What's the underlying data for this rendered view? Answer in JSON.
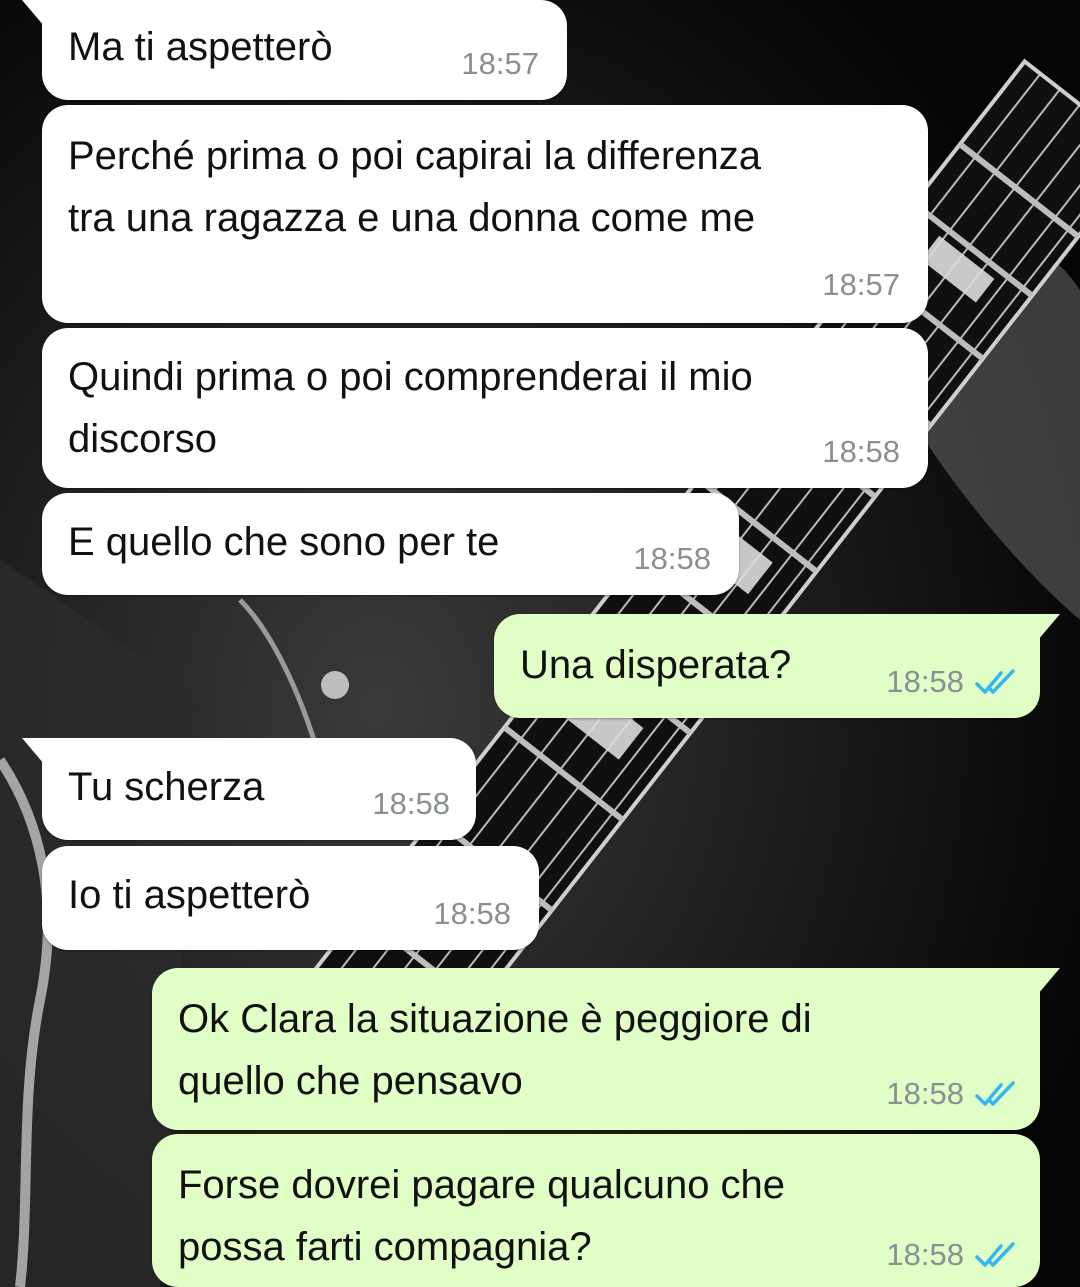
{
  "chat": {
    "accent_tick_color": "#34b7f1",
    "incoming_bubble_color": "#ffffff",
    "outgoing_bubble_color": "#e1fec6",
    "messages": [
      {
        "text": "Ma ti aspetterò",
        "time": "18:57",
        "direction": "incoming",
        "status": ""
      },
      {
        "text": "Perché prima o poi capirai la differenza\ntra una ragazza e una donna come me",
        "time": "18:57",
        "direction": "incoming",
        "status": ""
      },
      {
        "text": "Quindi prima o poi comprenderai il mio\ndiscorso",
        "time": "18:58",
        "direction": "incoming",
        "status": ""
      },
      {
        "text": "E quello che sono per te",
        "time": "18:58",
        "direction": "incoming",
        "status": ""
      },
      {
        "text": "Una disperata?",
        "time": "18:58",
        "direction": "outgoing",
        "status": "read"
      },
      {
        "text": "Tu scherza",
        "time": "18:58",
        "direction": "incoming",
        "status": ""
      },
      {
        "text": "Io ti aspetterò",
        "time": "18:58",
        "direction": "incoming",
        "status": ""
      },
      {
        "text": "Ok Clara la situazione è peggiore di\nquello che pensavo",
        "time": "18:58",
        "direction": "outgoing",
        "status": "read"
      },
      {
        "text": "Forse dovrei pagare qualcuno che\npossa farti compagnia?",
        "time": "18:58",
        "direction": "outgoing",
        "status": "read"
      }
    ]
  },
  "icons": {
    "read_receipt": "double-check-icon"
  },
  "wallpaper": {
    "description_icon": "guitar-wallpaper"
  }
}
